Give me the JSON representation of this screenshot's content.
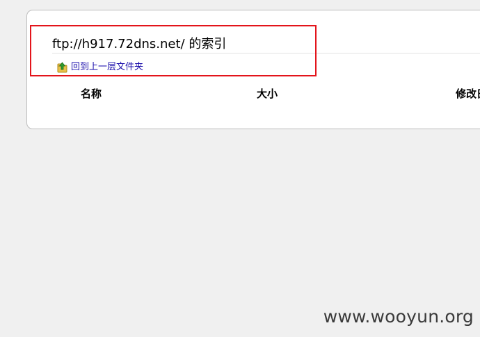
{
  "index": {
    "title": "ftp://h917.72dns.net/ 的索引",
    "up_link_label": "回到上一层文件夹",
    "up_icon": "folder-up-icon",
    "columns": [
      {
        "label": "名称"
      },
      {
        "label": "大小"
      },
      {
        "label": "修改日"
      }
    ]
  },
  "annotation": {
    "box_color": "#e3141b"
  },
  "watermark": {
    "text": "www.wooyun.org"
  },
  "colors": {
    "link": "#1a0dab",
    "background": "#f0f0f0",
    "card": "#ffffff"
  }
}
